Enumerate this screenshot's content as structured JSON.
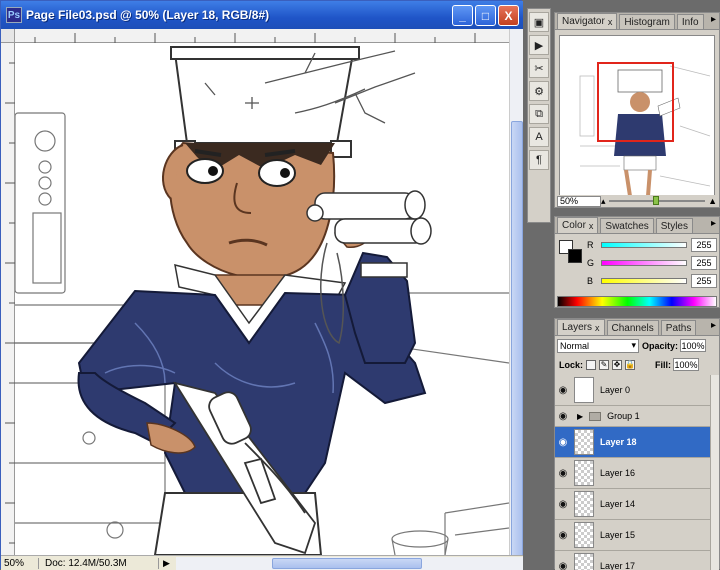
{
  "document": {
    "title": "Page File03.psd @ 50% (Layer 18, RGB/8#)",
    "app_icon": "Ps",
    "window_buttons": {
      "minimize": "_",
      "maximize": "□",
      "close": "X"
    }
  },
  "status": {
    "zoom": "50%",
    "doc_size": "Doc: 12.4M/50.3M",
    "arrow": "▶"
  },
  "tool_strip": [
    "navigate-icon",
    "play-icon",
    "tools-icon",
    "brush-preset-icon",
    "clone-icon",
    "character-icon",
    "paragraph-icon"
  ],
  "tool_glyphs": [
    "▣",
    "▶",
    "✂",
    "⚙",
    "⧉",
    "A",
    "¶"
  ],
  "navigator": {
    "tabs": [
      "Navigator",
      "Histogram",
      "Info"
    ],
    "close_x": "x",
    "menu": "▸",
    "zoom": "50%"
  },
  "color": {
    "tabs": [
      "Color",
      "Swatches",
      "Styles"
    ],
    "close_x": "x",
    "menu": "▸",
    "channels": [
      {
        "label": "R",
        "value": "255",
        "gradient": "linear-gradient(90deg,#00ffff,#ffffff)"
      },
      {
        "label": "G",
        "value": "255",
        "gradient": "linear-gradient(90deg,#ff00ff,#ffffff)"
      },
      {
        "label": "B",
        "value": "255",
        "gradient": "linear-gradient(90deg,#ffff00,#ffffff)"
      }
    ]
  },
  "layers": {
    "tabs": [
      "Layers",
      "Channels",
      "Paths"
    ],
    "close_x": "x",
    "menu": "▸",
    "blend_mode": "Normal",
    "opacity_label": "Opacity:",
    "opacity_value": "100%",
    "lock_label": "Lock:",
    "fill_label": "Fill:",
    "fill_value": "100%",
    "items": [
      {
        "name": "Layer 0",
        "type": "layer",
        "selected": false
      },
      {
        "name": "Group 1",
        "type": "group",
        "selected": false
      },
      {
        "name": "Layer 18",
        "type": "layer",
        "selected": true
      },
      {
        "name": "Layer 16",
        "type": "layer",
        "selected": false
      },
      {
        "name": "Layer 14",
        "type": "layer",
        "selected": false
      },
      {
        "name": "Layer 15",
        "type": "layer",
        "selected": false
      },
      {
        "name": "Layer 17",
        "type": "layer",
        "selected": false
      }
    ]
  },
  "colors": {
    "titlebar": "#2a63d4",
    "selection": "#316ac5",
    "navigator_box": "#e1251b",
    "sweater": "#2e3a6f"
  }
}
